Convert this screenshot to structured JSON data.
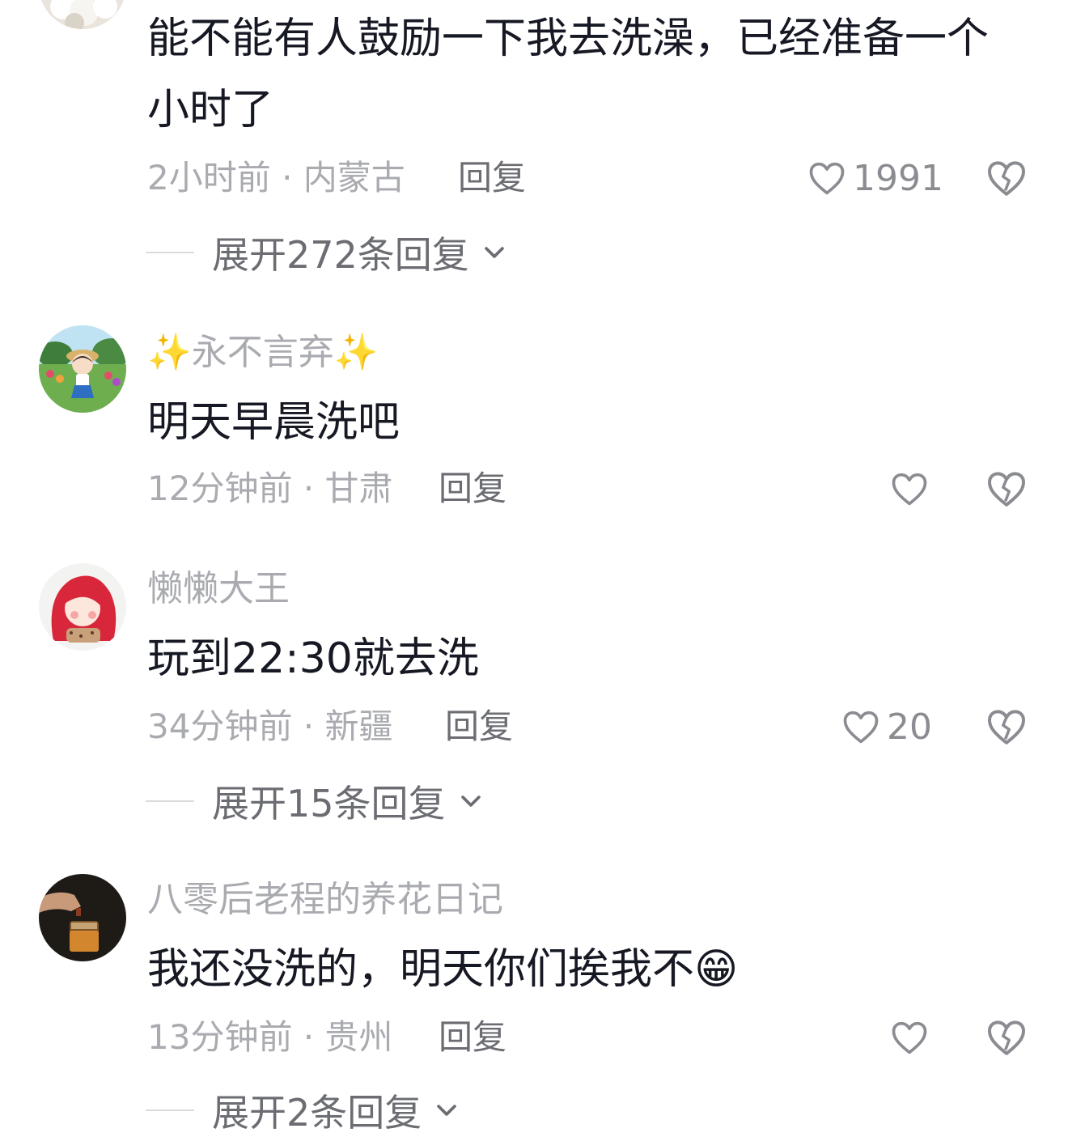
{
  "comments": [
    {
      "username": "",
      "text": "能不能有人鼓励一下我去洗澡，已经准备一个小时了",
      "meta": "2小时前 · 内蒙古",
      "reply": "回复",
      "likes": "1991",
      "expand": "展开272条回复"
    },
    {
      "username": "永不言弃",
      "sparkle": "✨",
      "text": "明天早晨洗吧",
      "meta": "12分钟前 · 甘肃",
      "reply": "回复",
      "likes": "",
      "expand": ""
    },
    {
      "username": "懒懒大王",
      "text": "玩到22:30就去洗",
      "meta": "34分钟前 · 新疆",
      "reply": "回复",
      "likes": "20",
      "expand": "展开15条回复"
    },
    {
      "username": "八零后老程的养花日记",
      "text": "我还没洗的，明天你们挨我不",
      "emoji": "😁",
      "meta": "13分钟前 · 贵州",
      "reply": "回复",
      "likes": "",
      "expand": "展开2条回复"
    }
  ],
  "icons": {
    "like": "heart-outline-icon",
    "dislike": "broken-heart-icon",
    "expand": "chevron-down-icon"
  },
  "colors": {
    "text": "#161823",
    "secondary": "#a9abb0",
    "reply": "#6b6d73",
    "sparkle": "#f5c21b"
  }
}
